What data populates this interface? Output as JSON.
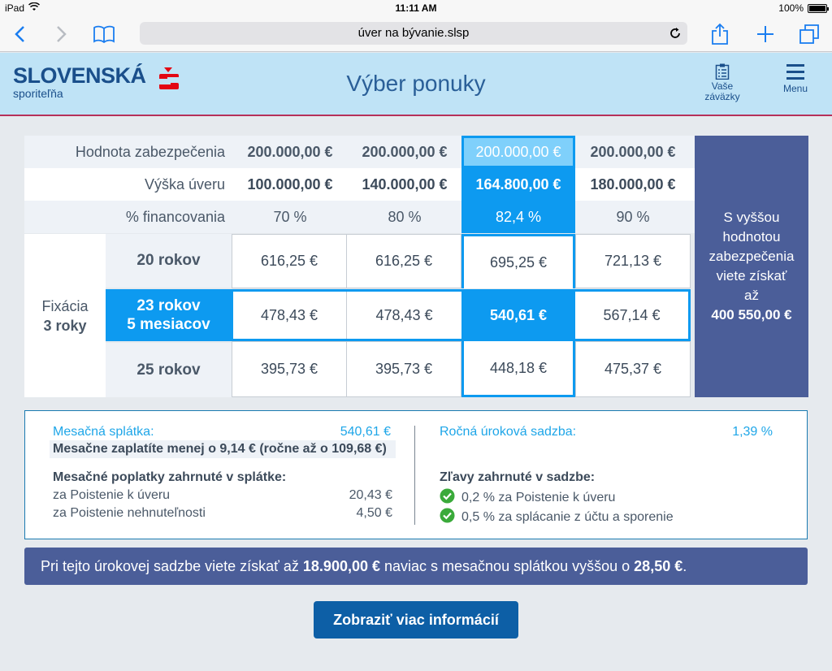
{
  "status": {
    "device": "iPad",
    "time": "11:11 AM",
    "battery": "100%"
  },
  "browser": {
    "url": "úver na bývanie.slsp"
  },
  "header": {
    "logo_main": "SLOVENSKÁ",
    "logo_sub": "sporiteľňa",
    "title": "Výber ponuky",
    "commitments_line1": "Vaše",
    "commitments_line2": "záväzky",
    "menu": "Menu"
  },
  "table": {
    "row_labels": [
      "Hodnota zabezpečenia",
      "Výška úveru",
      "% financovania"
    ],
    "columns": [
      {
        "security": "200.000,00 €",
        "loan": "100.000,00 €",
        "pct": "70 %"
      },
      {
        "security": "200.000,00 €",
        "loan": "140.000,00 €",
        "pct": "80 %"
      },
      {
        "security": "200.000,00 €",
        "loan": "164.800,00 €",
        "pct": "82,4 %"
      },
      {
        "security": "200.000,00 €",
        "loan": "180.000,00 €",
        "pct": "90 %"
      }
    ],
    "fixation_line1": "Fixácia",
    "fixation_line2": "3 roky",
    "terms": [
      {
        "line1": "20 rokov",
        "line2": ""
      },
      {
        "line1": "23 rokov",
        "line2": "5 mesiacov"
      },
      {
        "line1": "25 rokov",
        "line2": ""
      }
    ],
    "payments": [
      [
        "616,25 €",
        "616,25 €",
        "695,25 €",
        "721,13 €"
      ],
      [
        "478,43 €",
        "478,43 €",
        "540,61 €",
        "567,14 €"
      ],
      [
        "395,73 €",
        "395,73 €",
        "448,18 €",
        "475,37 €"
      ]
    ],
    "side_panel": {
      "line1": "S vyššou",
      "line2": "hodnotou",
      "line3": "zabezpečenia",
      "line4": "viete získať",
      "line5": "až",
      "amount": "400 550,00 €"
    }
  },
  "summary": {
    "monthly_label": "Mesačná splátka:",
    "monthly_value": "540,61 €",
    "monthly_saving": "Mesačne zaplatíte menej o 9,14 € (ročne až o 109,68 €)",
    "fees_title": "Mesačné poplatky zahrnuté v splátke:",
    "fees": [
      {
        "label": "za Poistenie k úveru",
        "value": "20,43 €"
      },
      {
        "label": "za Poistenie nehnuteľnosti",
        "value": "4,50 €"
      }
    ],
    "rate_label": "Ročná úroková sadzba:",
    "rate_value": "1,39 %",
    "discounts_title": "Zľavy zahrnuté v sadzbe:",
    "discounts": [
      "0,2 % za Poistenie k úveru",
      "0,5 % za splácanie z účtu a sporenie"
    ]
  },
  "banner": {
    "text1": "Pri tejto úrokovej sadzbe viete získať až ",
    "amount": "18.900,00 €",
    "text2": " naviac s mesačnou splátkou vyššou o ",
    "amount2": "28,50 €",
    "text3": "."
  },
  "cta": {
    "label": "Zobraziť viac informácií"
  },
  "colors": {
    "accent": "#0d9af0",
    "brand": "#1a4f8b",
    "panel": "#4b5e99",
    "selected_light": "#7fd0fb",
    "green_check": "#3aaa3a"
  }
}
